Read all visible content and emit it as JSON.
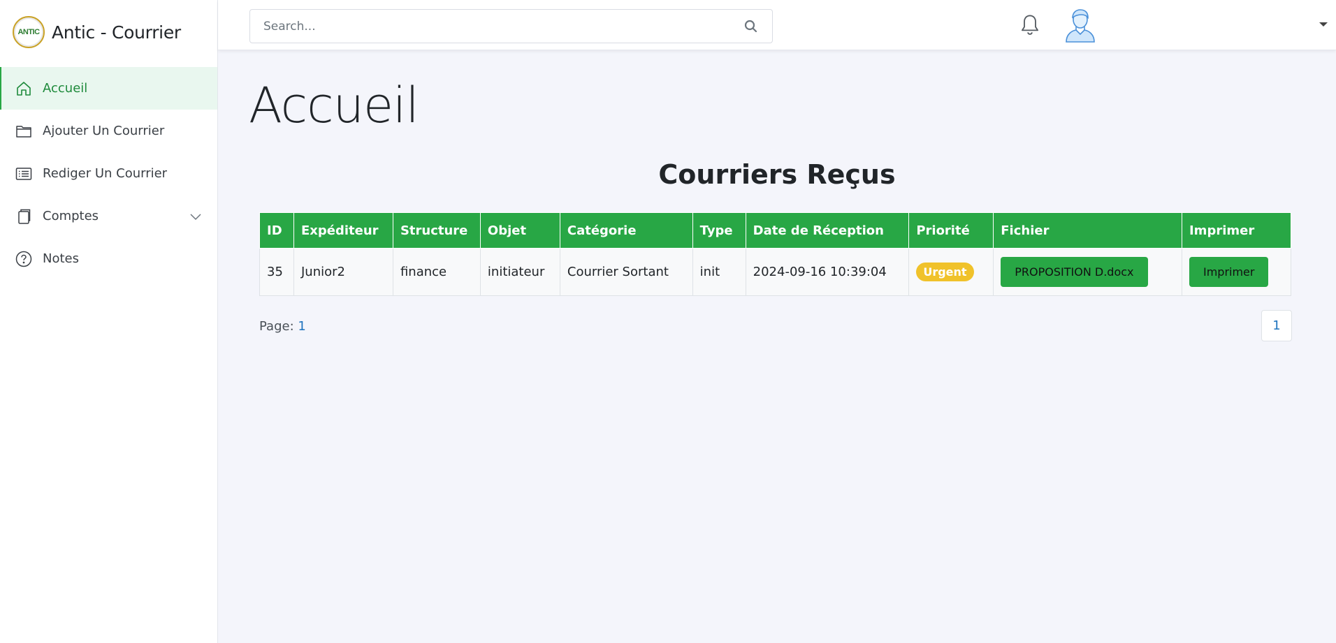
{
  "app": {
    "logo_text": "ANTIC",
    "title": "Antic - Courrier"
  },
  "sidebar": {
    "items": [
      {
        "label": "Accueil",
        "icon": "home-icon",
        "active": true
      },
      {
        "label": "Ajouter Un Courrier",
        "icon": "folder-icon"
      },
      {
        "label": "Rediger Un Courrier",
        "icon": "list-icon"
      },
      {
        "label": "Comptes",
        "icon": "copy-icon",
        "has_submenu": true
      },
      {
        "label": "Notes",
        "icon": "help-icon"
      }
    ]
  },
  "topbar": {
    "search_placeholder": "Search..."
  },
  "main": {
    "page_title": "Accueil",
    "section_title": "Courriers Reçus",
    "table": {
      "headers": [
        "ID",
        "Expéditeur",
        "Structure",
        "Objet",
        "Catégorie",
        "Type",
        "Date de Réception",
        "Priorité",
        "Fichier",
        "Imprimer"
      ],
      "rows": [
        {
          "id": "35",
          "expediteur": "Junior2",
          "structure": "finance",
          "objet": "initiateur",
          "categorie": "Courrier Sortant",
          "type": "init",
          "date": "2024-09-16 10:39:04",
          "priorite": "Urgent",
          "fichier": "PROPOSITION D.docx",
          "imprimer": "Imprimer"
        }
      ]
    },
    "pagination": {
      "label": "Page:",
      "current": "1",
      "pages": [
        "1"
      ]
    }
  },
  "colors": {
    "primary_green": "#28a745",
    "active_nav_bg": "#e9f7ef",
    "badge_urgent": "#f0c22a",
    "link_blue": "#1e73be"
  }
}
